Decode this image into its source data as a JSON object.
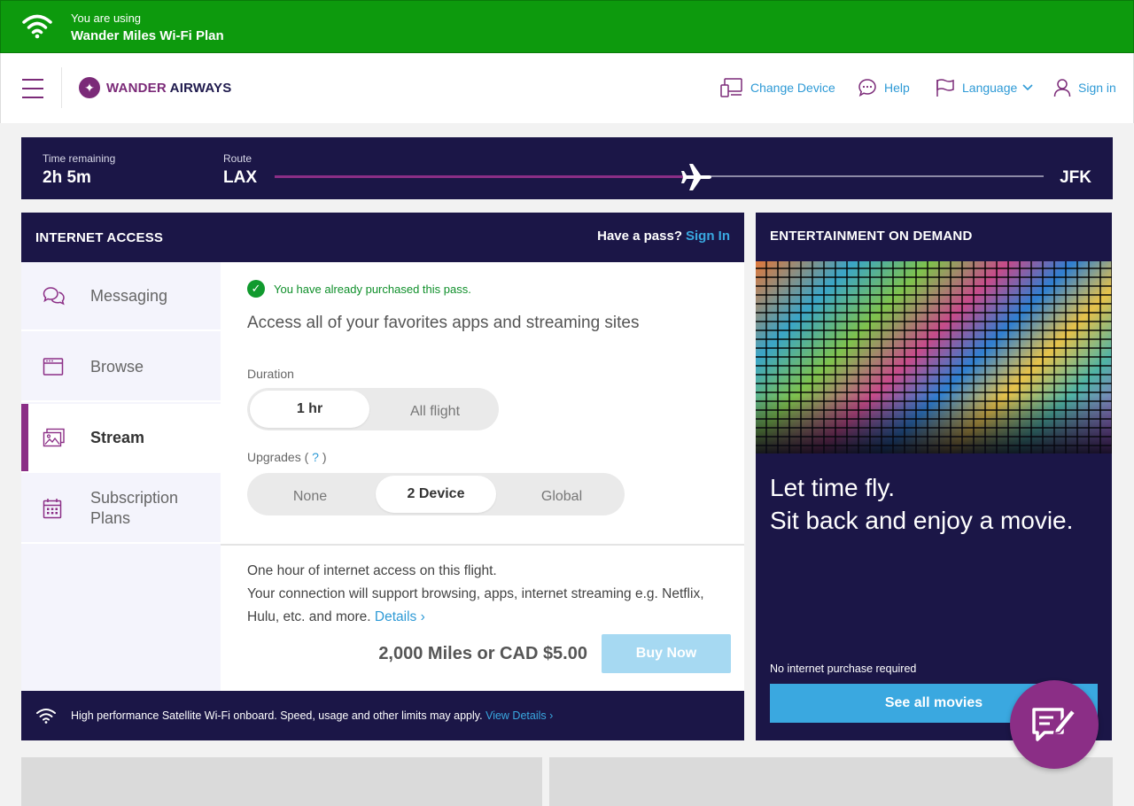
{
  "banner": {
    "line1": "You are using",
    "line2": "Wander Miles Wi-Fi Plan",
    "color": "#0d9a0d"
  },
  "header": {
    "brand_part1": "WANDER",
    "brand_part2": " AIRWAYS",
    "nav": {
      "change_device": "Change Device",
      "help": "Help",
      "language": "Language",
      "sign_in": "Sign in"
    }
  },
  "route": {
    "time_label": "Time remaining",
    "time_value": "2h 5m",
    "route_label": "Route",
    "origin": "LAX",
    "destination": "JFK",
    "progress": 0.55
  },
  "internet": {
    "title": "INTERNET ACCESS",
    "have_pass": "Have a pass?",
    "sign_in": "Sign In",
    "sidebar": [
      {
        "label": "Messaging",
        "icon": "chat-icon"
      },
      {
        "label": "Browse",
        "icon": "browser-icon"
      },
      {
        "label": "Stream",
        "icon": "images-icon",
        "active": true
      },
      {
        "label": "Subscription Plans",
        "icon": "calendar-icon"
      }
    ],
    "purchased_msg": "You have already purchased this pass.",
    "headline": "Access all of your favorites apps and streaming sites",
    "duration_label": "Duration",
    "duration_options": [
      "1 hr",
      "All flight"
    ],
    "duration_selected": "1 hr",
    "upgrades_label": "Upgrades (",
    "upgrades_q": "?",
    "upgrades_close": ")",
    "upgrade_options": [
      "None",
      "2 Device",
      "Global"
    ],
    "upgrade_selected": "2 Device",
    "desc_line1": "One hour of internet access on this flight.",
    "desc_line2": "Your connection will support browsing, apps, internet streaming e.g. Netflix, Hulu, etc. and more.",
    "details_link": "Details ›",
    "price": "2,000 Miles or CAD $5.00",
    "buy_label": "Buy Now",
    "footer_text": "High performance Satellite Wi-Fi onboard. Speed, usage and other limits may apply.",
    "footer_link": "View Details ›"
  },
  "entertainment": {
    "title": "ENTERTAINMENT ON DEMAND",
    "tagline1": "Let time fly.",
    "tagline2": "Sit back and enjoy a movie.",
    "no_purchase": "No internet purchase required",
    "see_all": "See all movies"
  },
  "colors": {
    "brand": "#7b2a78",
    "navy": "#1b1647",
    "link": "#2e9ad6",
    "accent_blue": "#3aa8e0"
  }
}
